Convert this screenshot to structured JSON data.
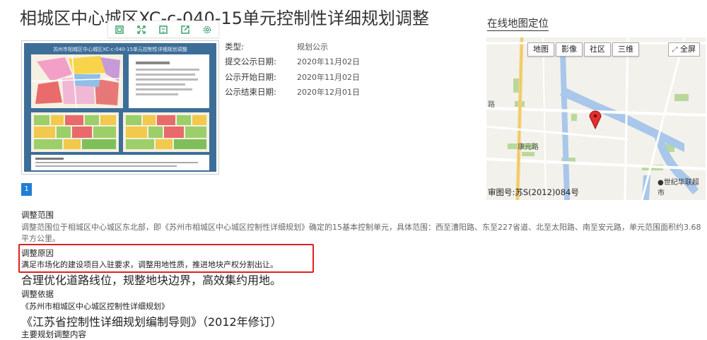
{
  "page": {
    "title": "相城区中心城区XC-c-040-15单元控制性详细规划调整"
  },
  "toolbar": {
    "buttons": [
      "copy-icon",
      "fullscreen-icon",
      "save-icon",
      "share-icon",
      "settings-icon"
    ]
  },
  "thumbnail": {
    "title": "苏州市相城区中心城区XC-c-040-15单元控制性详细规划调整"
  },
  "info": {
    "type_label": "类型:",
    "type_value": "规划公示",
    "submit_label": "提交公示日期:",
    "submit_value": "2020年11月02日",
    "start_label": "公示开始日期:",
    "start_value": "2020年11月02日",
    "end_label": "公示结束日期:",
    "end_value": "2020年12月01日"
  },
  "pagination": {
    "current": "1"
  },
  "map": {
    "link": "在线地图定位",
    "btn_map": "地图",
    "btn_image": "影像",
    "btn_community": "社区",
    "btn_3d": "三维",
    "btn_full": "全屏",
    "road1": "路",
    "road2": "康元路",
    "place": "●世纪华联超市",
    "approval": "审图号:苏S(2012)084号"
  },
  "content": {
    "scope_heading": "调整范围",
    "scope_text": "调整范围位于相城区中心城区东北部，即《苏州市相城区中心城区控制性详细规划》确定的15基本控制单元，具体范围：西至漕阳路、东至227省道、北至太阳路、南至安元路，单元范围面积约3.68平方公里。",
    "reason_heading": "调整原因",
    "reason_text": "满足市场化的建设项目入驻要求，调整用地性质，推进地块产权分割出让。",
    "big_line1": "合理优化道路线位，规整地块边界，高效集约用地。",
    "basis_heading": "调整依据",
    "basis_item1": "《苏州市相城区中心城区控制性详细规划》",
    "big_line2": "《江苏省控制性详细规划编制导则》（2012年修订）",
    "main_heading": "主要规划调整内容"
  }
}
